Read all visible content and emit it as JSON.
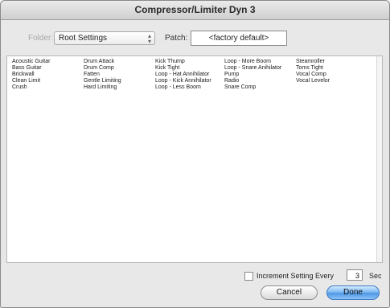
{
  "window": {
    "title": "Compressor/Limiter Dyn 3"
  },
  "toolbar": {
    "folder_label": "Folder:",
    "folder_value": "Root Settings",
    "patch_label": "Patch:",
    "patch_value": "<factory default>"
  },
  "presets": {
    "columns": [
      [
        "Acoustic Guitar",
        "Bass Guitar",
        "Brickwall",
        "Clean Limit",
        "Crush"
      ],
      [
        "Drum Attack",
        "Drum Comp",
        "Fatten",
        "Gentle Limiting",
        "Hard Limiting"
      ],
      [
        "Kick Thump",
        "Kick Tight",
        "Loop - Hat Annihilator",
        "Loop - Kick Annihilator",
        "Loop - Less Boom"
      ],
      [
        "Loop - More Boom",
        "Loop - Snare Anihilator",
        "Pump",
        "Radio",
        "Snare Comp"
      ],
      [
        "Steamroller",
        "Toms Tight",
        "Vocal Comp",
        "Vocal Levelor"
      ]
    ]
  },
  "footer": {
    "increment_label": "Increment Setting Every",
    "increment_checked": false,
    "seconds_value": "3",
    "seconds_unit": "Sec",
    "cancel_label": "Cancel",
    "done_label": "Done"
  },
  "colors": {
    "done_accent": "#4f98e6"
  }
}
